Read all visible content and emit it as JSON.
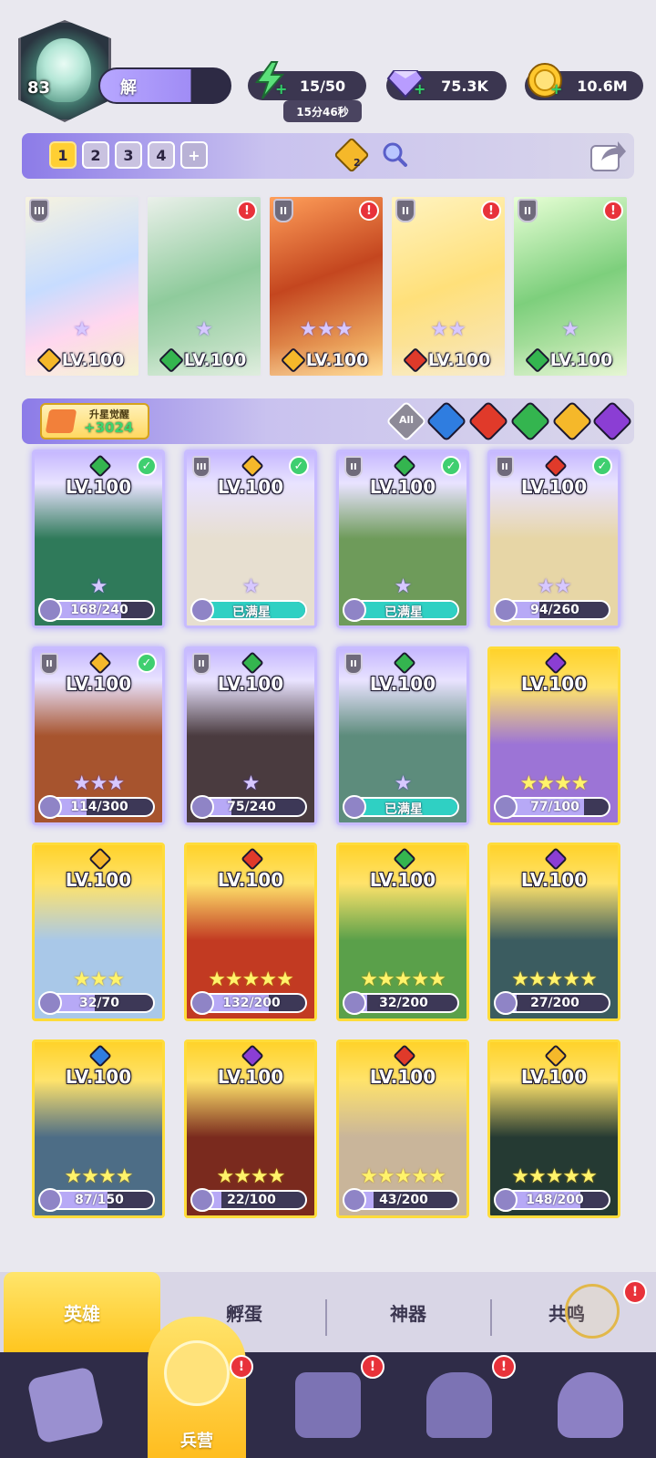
{
  "player": {
    "level": "83",
    "name_short": "解"
  },
  "resources": {
    "energy": {
      "value": "15/50",
      "icon": "lightning-icon",
      "timer": "15分46秒"
    },
    "gems": {
      "value": "75.3K",
      "icon": "diamond-icon"
    },
    "coins": {
      "value": "10.6M",
      "icon": "gold-coin-icon"
    }
  },
  "team_tabs": [
    "1",
    "2",
    "3",
    "4",
    "+"
  ],
  "team_tab_active": 0,
  "team_bonus": {
    "badge": "2"
  },
  "team": [
    {
      "level": "LV.100",
      "element": "light",
      "rank": "III",
      "stars": "★",
      "alert": false
    },
    {
      "level": "LV.100",
      "element": "wind",
      "rank": "",
      "stars": "★",
      "alert": true
    },
    {
      "level": "LV.100",
      "element": "light",
      "rank": "II",
      "stars": "★★★",
      "alert": true
    },
    {
      "level": "LV.100",
      "element": "fire",
      "rank": "II",
      "stars": "★★",
      "alert": true
    },
    {
      "level": "LV.100",
      "element": "wind",
      "rank": "II",
      "stars": "★",
      "alert": true
    }
  ],
  "awaken": {
    "title": "升星觉醒",
    "value": "+3024"
  },
  "filters": {
    "all_label": "All",
    "elements": [
      "water",
      "fire",
      "wind",
      "light",
      "dark"
    ]
  },
  "element_colors": {
    "light": "#f5b82a",
    "wind": "#34b54f",
    "fire": "#e03a2a",
    "water": "#2f7de0",
    "dark": "#8b3ed4"
  },
  "heroes": [
    {
      "level": "LV.100",
      "element": "wind",
      "rank": "",
      "check": true,
      "stars": "★",
      "star_color": "purple",
      "progress": "168/240",
      "fraction": 0.7,
      "full": false,
      "style": "owned",
      "bg": "#2f7a5a"
    },
    {
      "level": "LV.100",
      "element": "light",
      "rank": "III",
      "check": true,
      "stars": "★",
      "star_color": "purple",
      "progress": "已满星",
      "fraction": 1.0,
      "full": true,
      "style": "owned",
      "bg": "#e7dfd0"
    },
    {
      "level": "LV.100",
      "element": "wind",
      "rank": "II",
      "check": true,
      "stars": "★",
      "star_color": "purple",
      "progress": "已满星",
      "fraction": 1.0,
      "full": true,
      "style": "owned",
      "bg": "#6e9b5a"
    },
    {
      "level": "LV.100",
      "element": "fire",
      "rank": "II",
      "check": true,
      "stars": "★★",
      "star_color": "purple",
      "progress": "94/260",
      "fraction": 0.36,
      "full": false,
      "style": "owned",
      "bg": "#e7d6a6"
    },
    {
      "level": "LV.100",
      "element": "light",
      "rank": "II",
      "check": true,
      "stars": "★★★",
      "star_color": "purple",
      "progress": "114/300",
      "fraction": 0.38,
      "full": false,
      "style": "owned",
      "bg": "#a7542e"
    },
    {
      "level": "LV.100",
      "element": "wind",
      "rank": "II",
      "check": false,
      "stars": "★",
      "star_color": "purple",
      "progress": "75/240",
      "fraction": 0.31,
      "full": false,
      "style": "owned",
      "bg": "#4a3b3f"
    },
    {
      "level": "LV.100",
      "element": "wind",
      "rank": "II",
      "check": false,
      "stars": "★",
      "star_color": "purple",
      "progress": "已满星",
      "fraction": 1.0,
      "full": true,
      "style": "owned",
      "bg": "#5d8c7c"
    },
    {
      "level": "LV.100",
      "element": "dark",
      "rank": "",
      "check": false,
      "stars": "★★★★",
      "star_color": "yellow",
      "progress": "77/100",
      "fraction": 0.77,
      "full": false,
      "style": "gold",
      "bg": "#9c74d6"
    },
    {
      "level": "LV.100",
      "element": "light",
      "rank": "",
      "check": false,
      "stars": "★★★",
      "star_color": "yellow",
      "progress": "32/70",
      "fraction": 0.46,
      "full": false,
      "style": "gold",
      "bg": "#a9c8e8"
    },
    {
      "level": "LV.100",
      "element": "fire",
      "rank": "",
      "check": false,
      "stars": "★★★★★",
      "star_color": "yellow",
      "progress": "132/200",
      "fraction": 0.66,
      "full": false,
      "style": "gold",
      "bg": "#c23a22"
    },
    {
      "level": "LV.100",
      "element": "wind",
      "rank": "",
      "check": false,
      "stars": "★★★★★",
      "star_color": "yellow",
      "progress": "32/200",
      "fraction": 0.16,
      "full": false,
      "style": "gold",
      "bg": "#5aa04a"
    },
    {
      "level": "LV.100",
      "element": "dark",
      "rank": "",
      "check": false,
      "stars": "★★★★★",
      "star_color": "yellow",
      "progress": "27/200",
      "fraction": 0.135,
      "full": false,
      "style": "gold",
      "bg": "#3b5c60"
    },
    {
      "level": "LV.100",
      "element": "water",
      "rank": "",
      "check": false,
      "stars": "★★★★",
      "star_color": "yellow",
      "progress": "87/150",
      "fraction": 0.58,
      "full": false,
      "style": "gold",
      "bg": "#4d6d86"
    },
    {
      "level": "LV.100",
      "element": "dark",
      "rank": "",
      "check": false,
      "stars": "★★★★",
      "star_color": "yellow",
      "progress": "22/100",
      "fraction": 0.22,
      "full": false,
      "style": "gold",
      "bg": "#7a2a1e"
    },
    {
      "level": "LV.100",
      "element": "fire",
      "rank": "",
      "check": false,
      "stars": "★★★★★",
      "star_color": "yellow",
      "progress": "43/200",
      "fraction": 0.215,
      "full": false,
      "style": "gold",
      "bg": "#c9b59a"
    },
    {
      "level": "LV.100",
      "element": "light",
      "rank": "",
      "check": false,
      "stars": "★★★★★",
      "star_color": "yellow",
      "progress": "148/200",
      "fraction": 0.74,
      "full": false,
      "style": "gold",
      "bg": "#253a33"
    }
  ],
  "sub_tabs": [
    "英雄",
    "孵蛋",
    "神器",
    "共鸣"
  ],
  "bottom_nav": {
    "active_label": "兵营",
    "items": [
      "cards-icon",
      "barracks-icon",
      "map-icon",
      "temple-icon",
      "mushroom-house-icon"
    ]
  }
}
